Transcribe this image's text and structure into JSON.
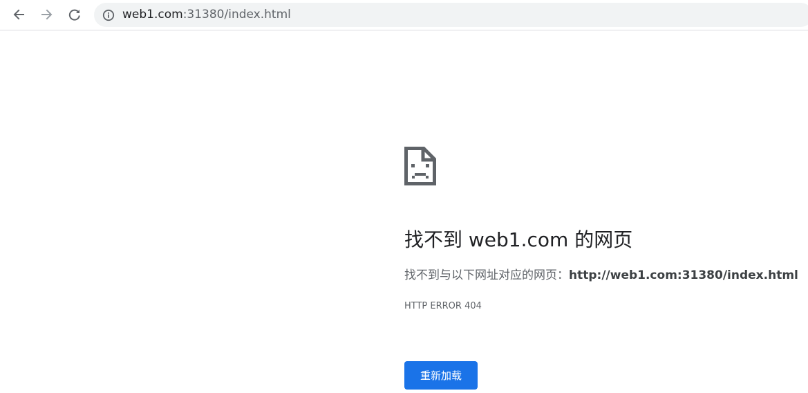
{
  "browser": {
    "url_host": "web1.com",
    "url_rest": ":31380/index.html",
    "back_icon": "arrow-left",
    "forward_icon": "arrow-right",
    "reload_icon": "reload",
    "info_icon": "info-circle"
  },
  "error_page": {
    "icon": "sad-page-icon",
    "headline": "找不到 web1.com 的网页",
    "description_prefix": "找不到与以下网址对应的网页：",
    "description_url": "http://web1.com:31380/index.html",
    "error_code": "HTTP ERROR 404",
    "reload_button": "重新加载",
    "accent_color": "#1a73e8"
  }
}
